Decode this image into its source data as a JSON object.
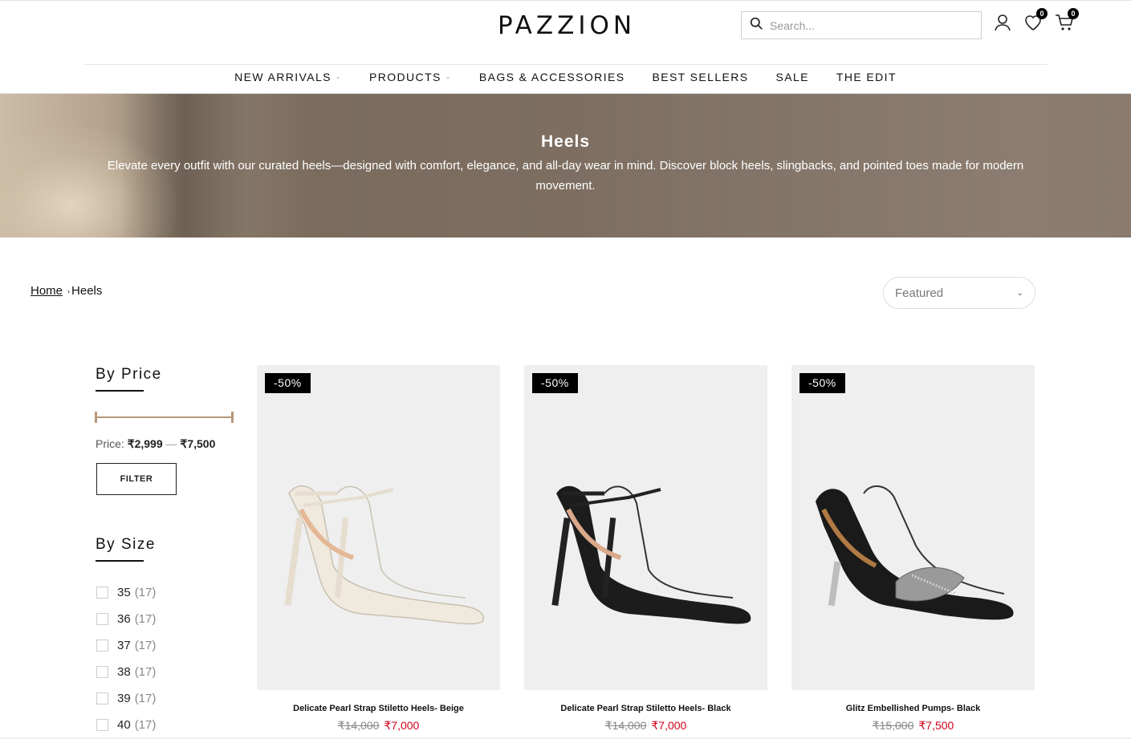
{
  "brand": {
    "logo": "PAZZION"
  },
  "header": {
    "search_placeholder": "Search...",
    "wishlist_count": "0",
    "cart_count": "0"
  },
  "nav": {
    "items": [
      {
        "label": "NEW ARRIVALS",
        "dropdown": true
      },
      {
        "label": "PRODUCTS",
        "dropdown": true
      },
      {
        "label": "BAGS & ACCESSORIES",
        "dropdown": false
      },
      {
        "label": "BEST SELLERS",
        "dropdown": false
      },
      {
        "label": "SALE",
        "dropdown": false
      },
      {
        "label": "THE EDIT",
        "dropdown": false
      }
    ]
  },
  "hero": {
    "title": "Heels",
    "description": "Elevate every outfit with our curated heels—designed with comfort, elegance, and all-day wear in mind. Discover block heels, slingbacks, and pointed toes made for modern movement."
  },
  "breadcrumb": {
    "home": "Home",
    "current": "Heels"
  },
  "sort": {
    "selected": "Featured"
  },
  "filters": {
    "price": {
      "title": "By Price",
      "label": "Price:",
      "min": "₹2,999",
      "separator": "—",
      "max": "₹7,500",
      "button": "FILTER"
    },
    "size": {
      "title": "By Size",
      "options": [
        {
          "size": "35",
          "count": "(17)"
        },
        {
          "size": "36",
          "count": "(17)"
        },
        {
          "size": "37",
          "count": "(17)"
        },
        {
          "size": "38",
          "count": "(17)"
        },
        {
          "size": "39",
          "count": "(17)"
        },
        {
          "size": "40",
          "count": "(17)"
        }
      ]
    }
  },
  "products": [
    {
      "badge": "-50%",
      "name": "Delicate Pearl Strap Stiletto Heels- Beige",
      "old_price": "₹14,000",
      "price": "₹7,000",
      "color": "#efe9de"
    },
    {
      "badge": "-50%",
      "name": "Delicate Pearl Strap Stiletto Heels- Black",
      "old_price": "₹14,000",
      "price": "₹7,000",
      "color": "#1c1c1c"
    },
    {
      "badge": "-50%",
      "name": "Glitz Embellished Pumps- Black",
      "old_price": "₹15,000",
      "price": "₹7,500",
      "color": "#1a1a1a"
    }
  ],
  "colors": {
    "accent": "#b8977a",
    "sale_price": "#d0011b",
    "badge_bg": "#000000"
  }
}
